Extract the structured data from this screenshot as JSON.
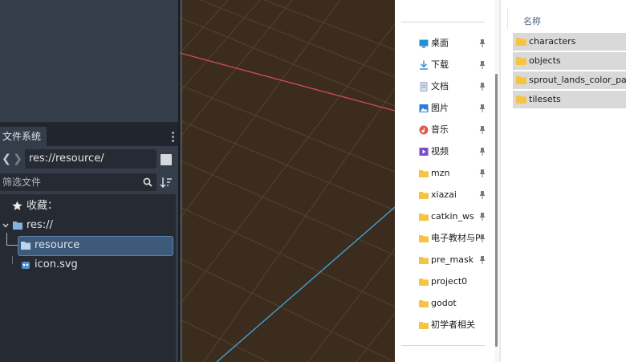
{
  "godot": {
    "filesystem_tab": "文件系统",
    "path": "res://resource/",
    "filter_placeholder": "筛选文件",
    "tree": {
      "favorites": "收藏：",
      "root": "res://",
      "folder": "resource",
      "file": "icon.svg"
    }
  },
  "explorer": {
    "column_name": "名称",
    "quick_access": [
      {
        "label": "桌面",
        "icon": "desktop-icon",
        "color": "#1e8fd6"
      },
      {
        "label": "下载",
        "icon": "download-icon",
        "color": "#1e8fd6"
      },
      {
        "label": "文档",
        "icon": "document-icon",
        "color": "#8aa0b8"
      },
      {
        "label": "图片",
        "icon": "pictures-icon",
        "color": "#2b7cd3"
      },
      {
        "label": "音乐",
        "icon": "music-icon",
        "color": "#e4584f"
      },
      {
        "label": "视频",
        "icon": "video-icon",
        "color": "#7a4fc2"
      },
      {
        "label": "mzn",
        "icon": "folder-icon",
        "color": "#f5c443"
      },
      {
        "label": "xiazai",
        "icon": "folder-icon",
        "color": "#f5c443"
      },
      {
        "label": "catkin_ws",
        "icon": "folder-icon",
        "color": "#f5c443"
      },
      {
        "label": "电子教材与PI",
        "icon": "folder-icon",
        "color": "#f5c443"
      },
      {
        "label": "pre_mask",
        "icon": "folder-icon",
        "color": "#f5c443"
      },
      {
        "label": "project0",
        "icon": "folder-icon",
        "color": "#f5c443"
      },
      {
        "label": "godot",
        "icon": "folder-icon",
        "color": "#f5c443"
      },
      {
        "label": "初学者相关",
        "icon": "folder-icon",
        "color": "#f5c443"
      }
    ],
    "files": [
      {
        "label": "characters"
      },
      {
        "label": "objects"
      },
      {
        "label": "sprout_lands_color_pallet"
      },
      {
        "label": "tilesets"
      }
    ]
  },
  "colors": {
    "viewport_bg": "#3c2c1e",
    "x_axis": "#d44a55",
    "z_axis": "#3fa7e0",
    "selection": "#3d5a7a",
    "folder": "#f5c443"
  }
}
